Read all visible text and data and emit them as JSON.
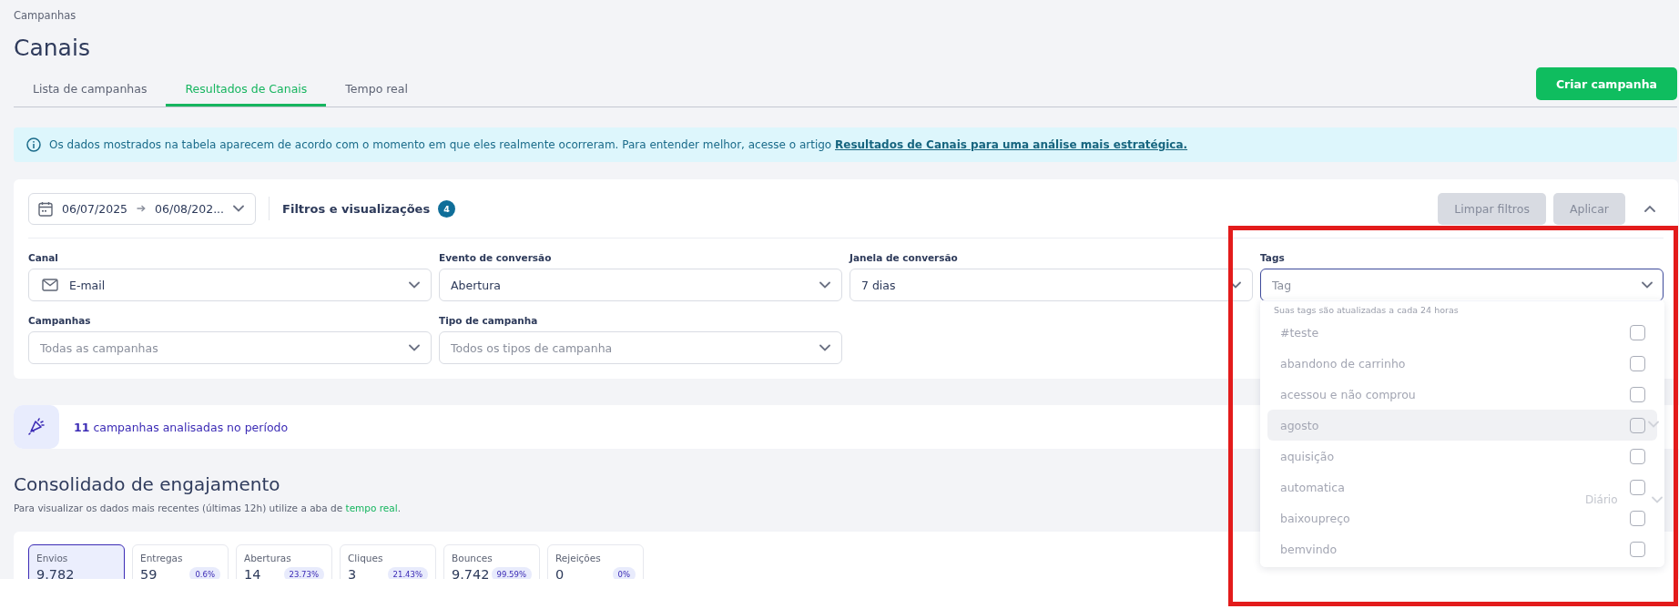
{
  "breadcrumb": "Campanhas",
  "title": "Canais",
  "tabs": [
    {
      "label": "Lista de campanhas",
      "selected": false
    },
    {
      "label": "Resultados de Canais",
      "selected": true
    },
    {
      "label": "Tempo real",
      "selected": false
    }
  ],
  "create_button": "Criar campanha",
  "info_banner": {
    "text": "Os dados mostrados na tabela aparecem de acordo com o momento em que eles realmente ocorreram. Para entender melhor, acesse o artigo",
    "link": "Resultados de Canais para uma análise mais estratégica."
  },
  "filters": {
    "date_start": "06/07/2025",
    "date_end": "06/08/202...",
    "title": "Filtros e visualizações",
    "count": "4",
    "expanded": true,
    "buttons": [
      {
        "label": "Limpar filtros",
        "disabled": true
      },
      {
        "label": "Aplicar",
        "disabled": true
      }
    ],
    "fields": [
      {
        "kind": "channel",
        "label": "Canal",
        "value": "E-mail"
      },
      {
        "kind": "select",
        "label": "Evento de conversão",
        "value": "Abertura"
      },
      {
        "kind": "select",
        "label": "Janela de conversão",
        "value": "7 dias"
      },
      {
        "kind": "tag",
        "label": "Tags",
        "placeholder": "Tag",
        "focused": true
      },
      {
        "kind": "select",
        "label": "Campanhas",
        "placeholder": "Todas as campanhas"
      },
      {
        "kind": "select",
        "label": "Tipo de campanha",
        "placeholder": "Todos os tipos de campanha"
      }
    ]
  },
  "tags_dropdown": {
    "note": "Suas tags são atualizadas a cada 24 horas",
    "options": [
      {
        "label": "#teste",
        "checked": false,
        "highlighted": false
      },
      {
        "label": "abandono de carrinho",
        "checked": false,
        "highlighted": false
      },
      {
        "label": "acessou e não comprou",
        "checked": false,
        "highlighted": false
      },
      {
        "label": "agosto",
        "checked": false,
        "highlighted": true
      },
      {
        "label": "aquisição",
        "checked": false,
        "highlighted": false
      },
      {
        "label": "automatica",
        "checked": false,
        "highlighted": false
      },
      {
        "label": "baixoupreço",
        "checked": false,
        "highlighted": false
      },
      {
        "label": "bemvindo",
        "checked": false,
        "highlighted": false
      }
    ]
  },
  "campaign_count": "**11** campanhas analisadas no período",
  "engagement": {
    "title": "Consolidado de engajamento",
    "subtitle": "Para visualizar os dados mais recentes (últimas 12h) utilize a aba de ",
    "subtitle_link": "tempo real",
    "subtitle_end": ".",
    "period_select": "Diário",
    "metrics": [
      {
        "label": "Envios",
        "value": "9.782",
        "selected": true
      },
      {
        "label": "Entregas",
        "value": "59",
        "rate": "0.6%",
        "selected": false
      },
      {
        "label": "Aberturas",
        "value": "14",
        "rate": "23.73%",
        "selected": false
      },
      {
        "label": "Cliques",
        "value": "3",
        "rate": "21.43%",
        "selected": false
      },
      {
        "label": "Bounces",
        "value": "9.742",
        "rate": "99.59%",
        "selected": false
      },
      {
        "label": "Rejeições",
        "value": "0",
        "rate": "0%",
        "selected": false
      }
    ]
  },
  "annotation": {
    "kind": "rectangle",
    "color": "#e31b1b"
  }
}
